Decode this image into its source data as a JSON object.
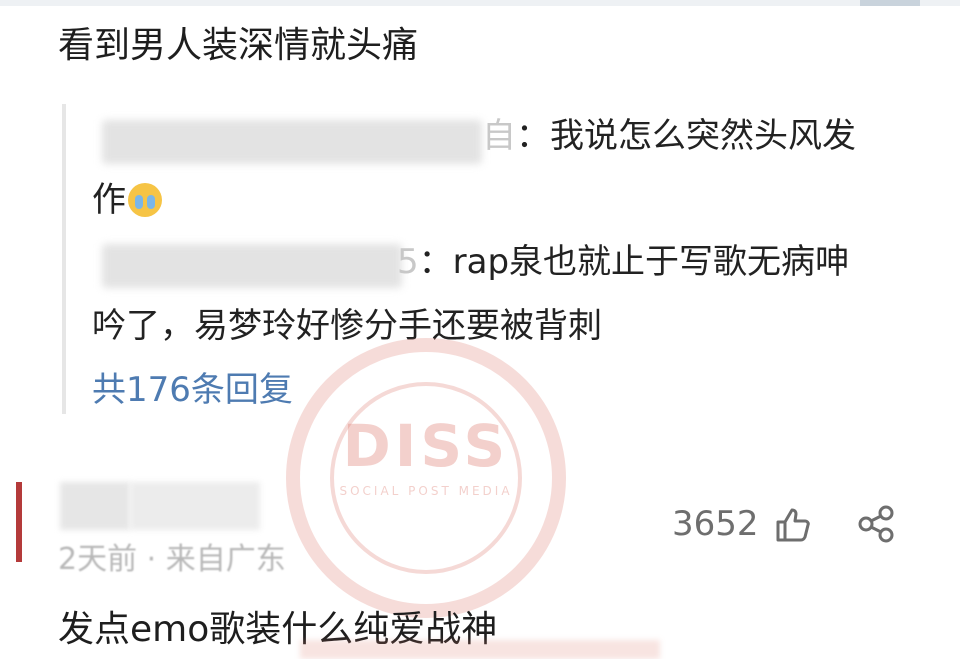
{
  "comment": {
    "text": "看到男人装深情就头痛"
  },
  "replies": [
    {
      "author_suffix": "自",
      "text_line1": "：我说怎么突然头风发",
      "text_line2": "作"
    },
    {
      "author_suffix": "5",
      "text_line1": "：rap泉也就止于写歌无病呻",
      "text_line2": "吟了，易梦玲好惨分手还要被背刺"
    }
  ],
  "more_replies": "共176条回复",
  "footer": {
    "meta": "2天前 · 来自广东",
    "like_count": "3652"
  },
  "next_comment": {
    "text": "发点emo歌装什么纯爱战神"
  },
  "watermark": {
    "text": "DISS",
    "sub": "SOCIAL POST MEDIA"
  },
  "colors": {
    "link": "#4e7bb1",
    "watermark": "#de8278"
  },
  "icons": [
    "crying-emoji-icon",
    "thumbs-up-icon",
    "share-icon"
  ]
}
